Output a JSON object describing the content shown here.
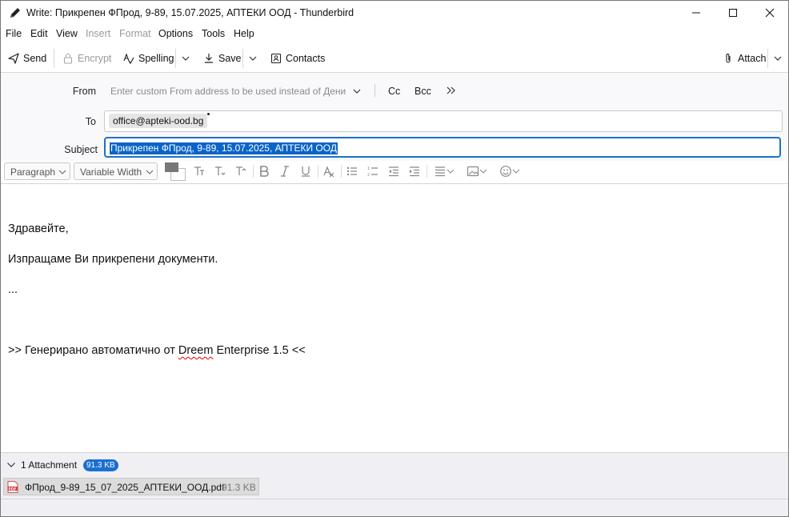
{
  "window": {
    "title": "Write: Прикрепен ФПрод, 9-89, 15.07.2025, АПТЕКИ ООД - Thunderbird"
  },
  "menu": {
    "file": "File",
    "edit": "Edit",
    "view": "View",
    "insert": "Insert",
    "format": "Format",
    "options": "Options",
    "tools": "Tools",
    "help": "Help"
  },
  "toolbar": {
    "send": "Send",
    "encrypt": "Encrypt",
    "spelling": "Spelling",
    "save": "Save",
    "contacts": "Contacts",
    "attach": "Attach"
  },
  "header": {
    "from_label": "From",
    "from_placeholder": "Enter custom From address to be used instead of Дени",
    "cc": "Cc",
    "bcc": "Bcc",
    "to_label": "To",
    "to_recipient": "office@apteki-ood.bg",
    "subject_label": "Subject",
    "subject_value": "Прикрепен ФПрод, 9-89, 15.07.2025, АПТЕКИ ООД"
  },
  "format": {
    "paragraph": "Paragraph",
    "font": "Variable Width"
  },
  "body": {
    "line1": "Здравейте,",
    "line2": "Изпращаме Ви прикрепени документи.",
    "line3": "...",
    "line4_prefix": ">> Генерирано автоматично от ",
    "line4_misspelled": "Dreem",
    "line4_suffix": " Enterprise 1.5 <<"
  },
  "attachments": {
    "summary": "1 Attachment",
    "total_size": "91.3 KB",
    "items": [
      {
        "name": "ФПрод_9-89_15_07_2025_АПТЕКИ_ООД.pdf",
        "size": "91.3 KB",
        "type_label": "PDF"
      }
    ]
  },
  "colors": {
    "accent": "#1a73c8",
    "selection": "#0a64c7",
    "badge": "#1a6fd0",
    "pdf_icon": "#d32f2f"
  }
}
